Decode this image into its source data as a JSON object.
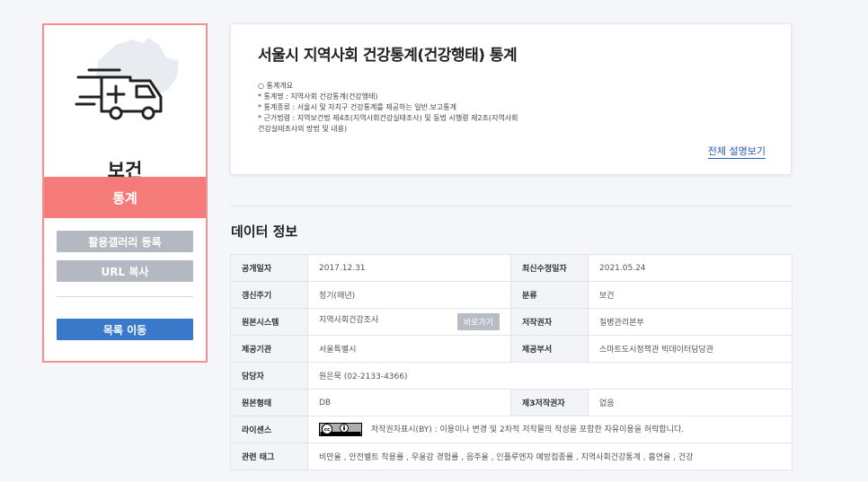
{
  "category": {
    "title": "보건",
    "tab": "통계"
  },
  "sidebar": {
    "gallery_btn": "활용갤러리 등록",
    "url_btn": "URL 복사",
    "list_btn": "목록 이동"
  },
  "description": {
    "title": "서울시 지역사회 건강통계(건강행태) 통계",
    "lines": [
      "○ 통계개요",
      "* 통계명 : 지역사회 건강통계(건강행태)",
      "* 통계종류 : 서울시 및 자치구 건강통계를 제공하는 일반.보고통계",
      "* 근거법령 : 지역보건법 제4조(지역사회건강실태조사) 및 동법 시행령 제2조(지역사회",
      "건강실태조사의 방법 및 내용)"
    ],
    "more_link": "전체 설명보기"
  },
  "section": {
    "title": "데이터 정보"
  },
  "info": {
    "published_label": "공개일자",
    "published_value": "2017.12.31",
    "modified_label": "최신수정일자",
    "modified_value": "2021.05.24",
    "cycle_label": "갱신주기",
    "cycle_value": "정기(매년)",
    "class_label": "분류",
    "class_value": "보건",
    "system_label": "원본시스템",
    "system_value": "지역사회건강조사",
    "go_btn": "바로가기",
    "author_label": "저작권자",
    "author_value": "질병관리본부",
    "provider_label": "제공기관",
    "provider_value": "서울특별시",
    "dept_label": "제공부서",
    "dept_value": "스마트도시정책관 빅데이터담당관",
    "manager_label": "담당자",
    "manager_value": "원은묵 (02-2133-4366)",
    "format_label": "원본형태",
    "format_value": "DB",
    "third_label": "제3저작권자",
    "third_value": "없음",
    "license_label": "라이센스",
    "license_value": "저작권자표시(BY) : 이용이나 변경 및 2차적 저작물의 작성을 포함한 자유이용을 허락합니다.",
    "tags_label": "관련 태그",
    "tags_value": "비만율 , 안전벨트 착용률 , 우울감 경험률 , 음주율 , 인플루엔자 예방접종률 , 지역사회건강통계 , 흡연율 , 건강"
  },
  "icons": [
    "ambulance-icon",
    "seoul-map-icon",
    "cc-by-license-icon"
  ],
  "colors": {
    "accent_red": "#f57a7a",
    "border_red": "#f58e8e",
    "button_blue": "#3a79c9",
    "button_gray": "#b4b8c0",
    "link_blue": "#2b5fb4"
  }
}
